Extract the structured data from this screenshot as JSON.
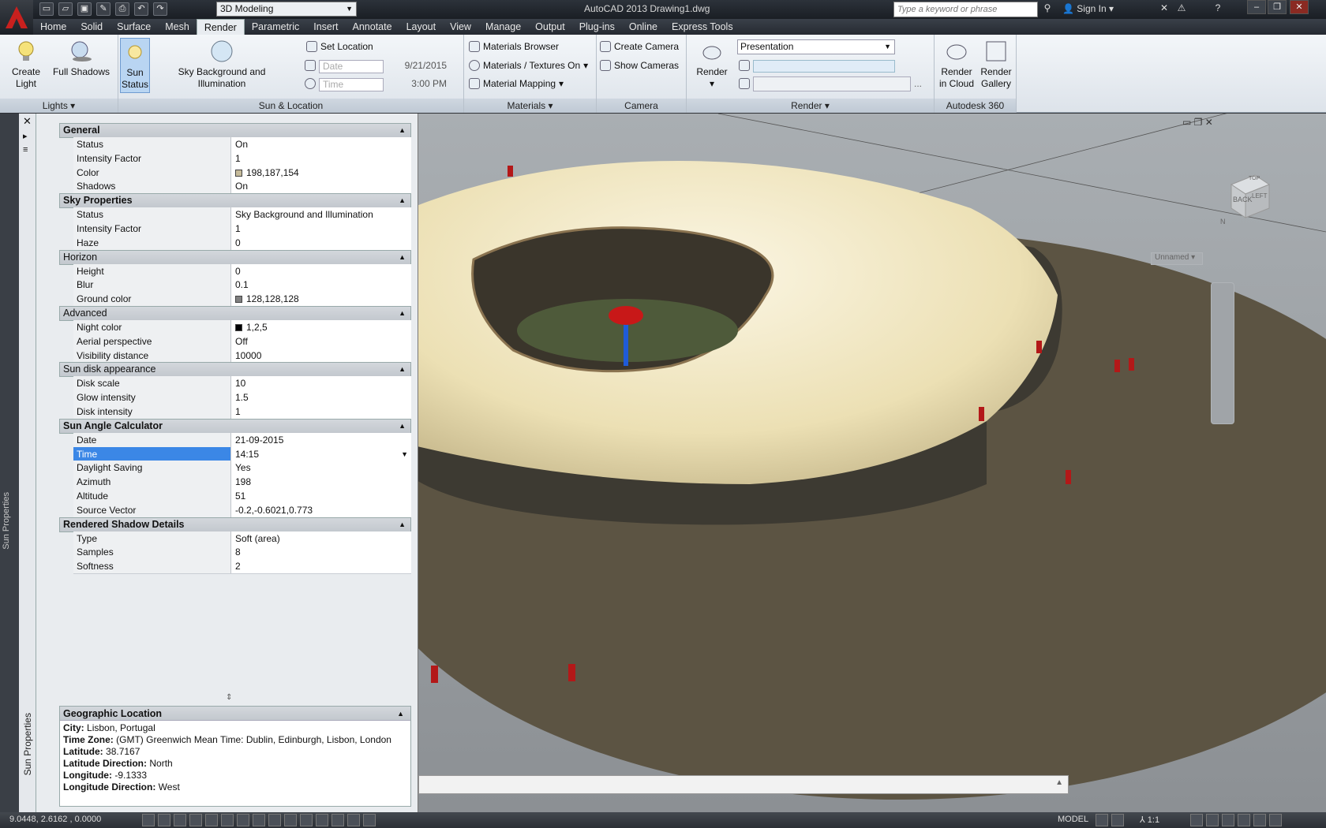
{
  "app": {
    "title": "AutoCAD 2013    Drawing1.dwg",
    "workspace": "3D Modeling",
    "search_placeholder": "Type a keyword or phrase",
    "sign_in": "Sign In"
  },
  "tabs": [
    "Home",
    "Solid",
    "Surface",
    "Mesh",
    "Render",
    "Parametric",
    "Insert",
    "Annotate",
    "Layout",
    "View",
    "Manage",
    "Output",
    "Plug-ins",
    "Online",
    "Express Tools"
  ],
  "active_tab": "Render",
  "ribbon": {
    "lights": {
      "label": "Lights",
      "create_light": "Create Light",
      "full_shadows": "Full Shadows"
    },
    "sun": {
      "label": "Sun & Location",
      "sun_status": "Sun Status",
      "sky": "Sky Background and Illumination",
      "set_location": "Set Location",
      "date_placeholder": "Date",
      "date_value": "9/21/2015",
      "time_placeholder": "Time",
      "time_value": "3:00 PM"
    },
    "materials": {
      "label": "Materials",
      "browser": "Materials Browser",
      "textures": "Materials / Textures On",
      "mapping": "Material Mapping"
    },
    "camera": {
      "label": "Camera",
      "create": "Create Camera",
      "show": "Show  Cameras"
    },
    "render": {
      "label": "Render",
      "button": "Render",
      "preset": "Presentation",
      "more": "..."
    },
    "a360": {
      "label": "Autodesk 360",
      "cloud": "Render in Cloud",
      "gallery": "Render Gallery"
    }
  },
  "palette": {
    "title": "Sun Properties",
    "sections": [
      {
        "name": "General",
        "rows": [
          [
            "Status",
            "On"
          ],
          [
            "Intensity Factor",
            "1"
          ],
          [
            "Color",
            "198,187,154"
          ],
          [
            "Shadows",
            "On"
          ]
        ]
      },
      {
        "name": "Sky Properties",
        "rows": [
          [
            "Status",
            "Sky Background and Illumination"
          ],
          [
            "Intensity Factor",
            "1"
          ],
          [
            "Haze",
            "0"
          ]
        ]
      },
      {
        "name": "Horizon",
        "rows": [
          [
            "Height",
            "0"
          ],
          [
            "Blur",
            "0.1"
          ],
          [
            "Ground color",
            "128,128,128"
          ]
        ]
      },
      {
        "name": "Advanced",
        "rows": [
          [
            "Night color",
            "1,2,5"
          ],
          [
            "Aerial perspective",
            "Off"
          ],
          [
            "Visibility distance",
            "10000"
          ]
        ]
      },
      {
        "name": "Sun disk appearance",
        "rows": [
          [
            "Disk scale",
            "10"
          ],
          [
            "Glow intensity",
            "1.5"
          ],
          [
            "Disk intensity",
            "1"
          ]
        ]
      },
      {
        "name": "Sun Angle Calculator",
        "rows": [
          [
            "Date",
            "21-09-2015"
          ],
          [
            "Time",
            "14:15"
          ],
          [
            "Daylight Saving",
            "Yes"
          ],
          [
            "Azimuth",
            "198"
          ],
          [
            "Altitude",
            "51"
          ],
          [
            "Source Vector",
            "-0.2,-0.6021,0.773"
          ]
        ]
      },
      {
        "name": "Rendered Shadow Details",
        "rows": [
          [
            "Type",
            "Soft (area)"
          ],
          [
            "Samples",
            "8"
          ],
          [
            "Softness",
            "2"
          ]
        ]
      }
    ],
    "swatches": {
      "color": "#c6bb9a",
      "ground": "#808080",
      "night": "#010205"
    },
    "geo": {
      "header": "Geographic Location",
      "lines": [
        [
          "City:",
          "Lisbon, Portugal"
        ],
        [
          "Time Zone:",
          "(GMT) Greenwich Mean Time: Dublin, Edinburgh, Lisbon, London"
        ],
        [
          "Latitude:",
          "38.7167"
        ],
        [
          "Latitude Direction:",
          "North"
        ],
        [
          "Longitude:",
          "-9.1333"
        ],
        [
          "Longitude Direction:",
          "West"
        ]
      ]
    }
  },
  "viewcube": {
    "back": "BACK",
    "left": "LEFT",
    "top": "TOP",
    "north": "N",
    "view": "Unnamed"
  },
  "status": {
    "coords": "9.0448, 2.6162 , 0.0000",
    "model": "MODEL",
    "scale": "1:1"
  }
}
